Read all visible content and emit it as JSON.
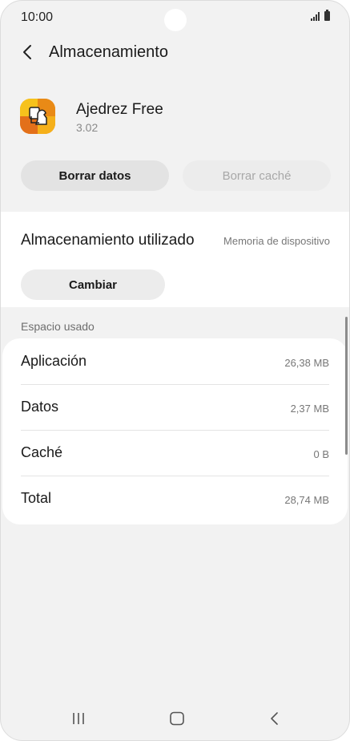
{
  "status_bar": {
    "time": "10:00"
  },
  "header": {
    "title": "Almacenamiento"
  },
  "app": {
    "name": "Ajedrez Free",
    "version": "3.02"
  },
  "actions": {
    "clear_data": "Borrar datos",
    "clear_cache": "Borrar caché"
  },
  "storage": {
    "label": "Almacenamiento utilizado",
    "location": "Memoria de dispositivo",
    "change_label": "Cambiar"
  },
  "usage": {
    "section_label": "Espacio usado",
    "rows": [
      {
        "name": "Aplicación",
        "size": "26,38 MB"
      },
      {
        "name": "Datos",
        "size": "2,37 MB"
      },
      {
        "name": "Caché",
        "size": "0 B"
      },
      {
        "name": "Total",
        "size": "28,74 MB"
      }
    ]
  },
  "icons": {
    "back": "back-arrow-icon",
    "app": "chess-app-icon",
    "nav_recents": "recent-apps-icon",
    "nav_home": "home-icon",
    "nav_back": "nav-back-icon"
  }
}
